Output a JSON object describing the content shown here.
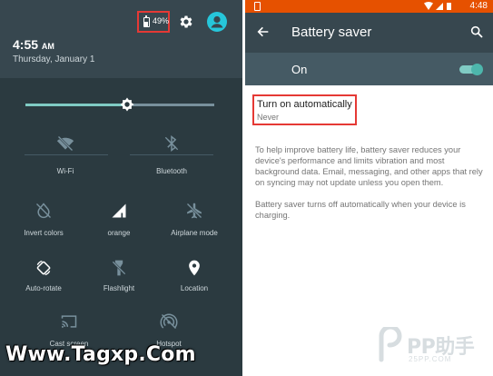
{
  "notification_shade": {
    "battery_percent": "49%",
    "time": "4:55",
    "time_suffix": "AM",
    "date": "Thursday, January 1",
    "brightness_level": 0.54,
    "tiles": [
      {
        "label": "Wi-Fi",
        "icon": "wifi-off-icon"
      },
      {
        "label": "Bluetooth",
        "icon": "bluetooth-off-icon"
      },
      {
        "label": "Invert colors",
        "icon": "invert-colors-icon"
      },
      {
        "label": "orange",
        "icon": "cell-signal-icon"
      },
      {
        "label": "Airplane mode",
        "icon": "airplane-off-icon"
      },
      {
        "label": "Auto-rotate",
        "icon": "auto-rotate-icon"
      },
      {
        "label": "Flashlight",
        "icon": "flashlight-off-icon"
      },
      {
        "label": "Location",
        "icon": "location-icon"
      },
      {
        "label": "Cast screen",
        "icon": "cast-icon"
      },
      {
        "label": "Hotspot",
        "icon": "hotspot-off-icon"
      }
    ]
  },
  "settings": {
    "status_time": "4:48",
    "title": "Battery saver",
    "switch_label": "On",
    "switch_on": true,
    "auto_title": "Turn on automatically",
    "auto_value": "Never",
    "description_1": "To help improve battery life, battery saver reduces your device's performance and limits vibration and most background data. Email, messaging, and other apps that rely on syncing may not update unless you open them.",
    "description_2": "Battery saver turns off automatically when your device is charging."
  },
  "watermarks": {
    "left": "Www.Tagxp.Com",
    "right_brand": "PP助手",
    "right_url": "25PP.COM"
  },
  "colors": {
    "shade_background": "#2b3a40",
    "shade_header": "#37474f",
    "accent_teal": "#80cbc4",
    "status_bar_orange": "#e65100",
    "toolbar": "#37474f",
    "highlight_red": "#e53935"
  }
}
